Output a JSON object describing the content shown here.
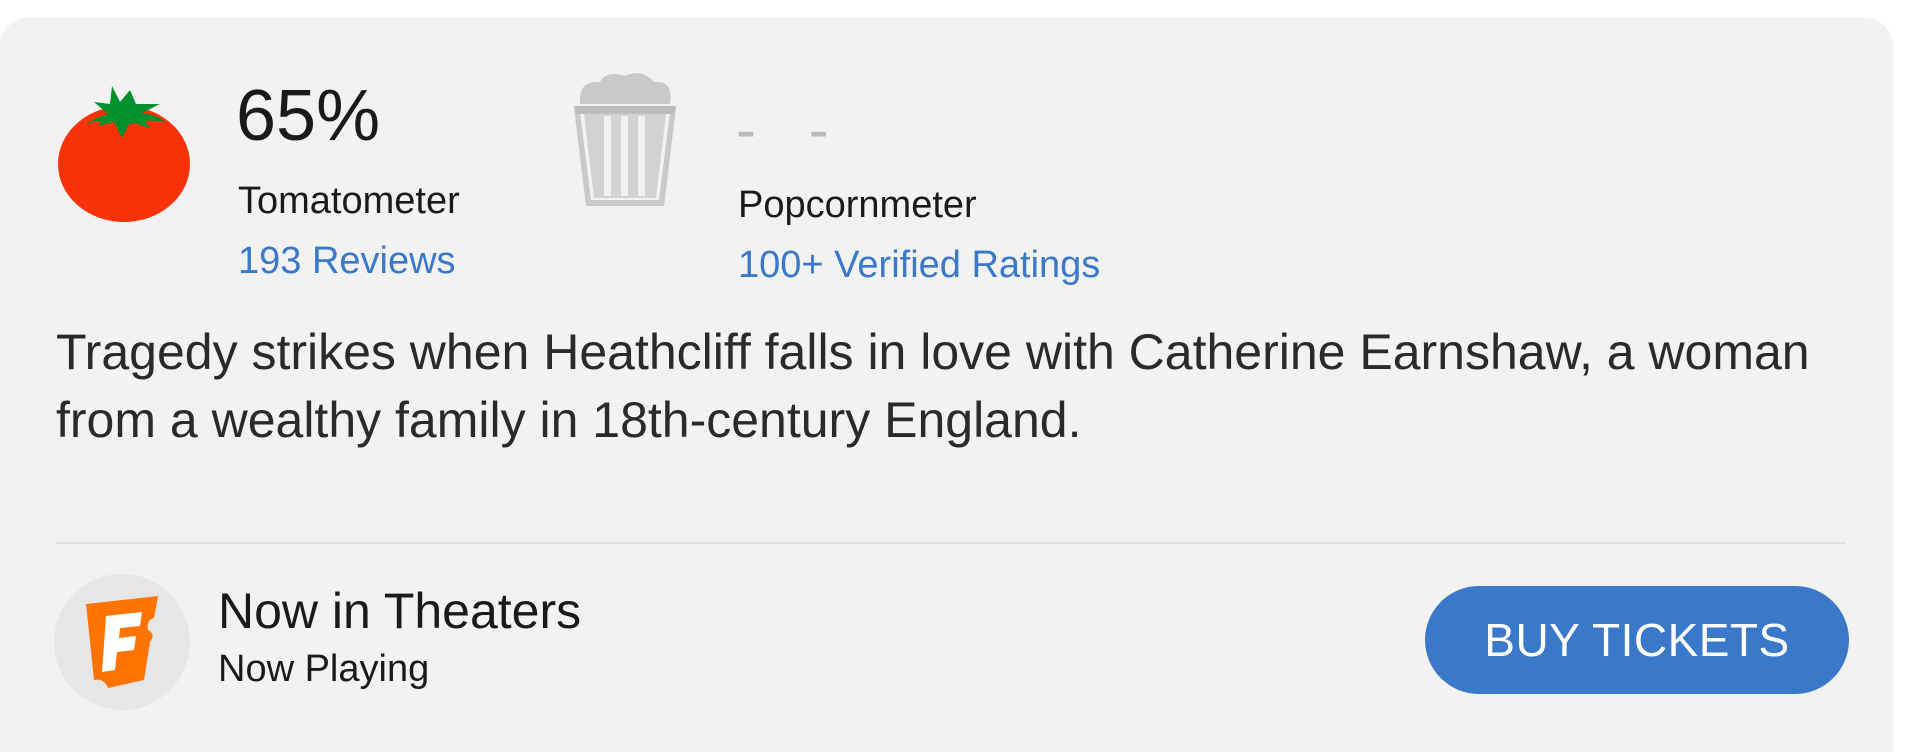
{
  "tomatometer": {
    "score": "65%",
    "label": "Tomatometer",
    "reviews": "193 Reviews",
    "icon": "tomato-icon",
    "color": "#ff3a12"
  },
  "popcornmeter": {
    "score": "- -",
    "label": "Popcornmeter",
    "ratings": "100+ Verified Ratings",
    "icon": "popcorn-bucket-icon"
  },
  "synopsis": "Tragedy strikes when Heathcliff falls in love with Catherine Earnshaw, a woman from a wealthy family in 18th-century England.",
  "theaters": {
    "title": "Now in Theaters",
    "subtitle": "Now Playing",
    "icon": "fandango-icon",
    "button_label": "BUY TICKETS"
  },
  "colors": {
    "link": "#3a78c9",
    "button": "#3a78c9",
    "card_bg": "#f2f2f2",
    "fandango_orange": "#ff7300"
  }
}
